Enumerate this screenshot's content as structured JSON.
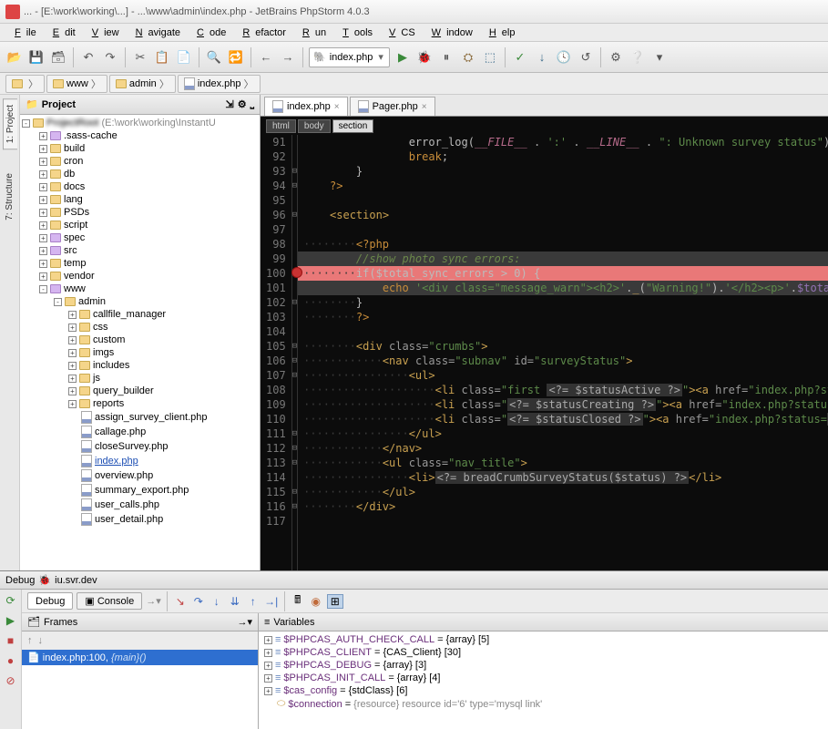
{
  "titlebar": "... - [E:\\work\\working\\...] - ...\\www\\admin\\index.php - JetBrains PhpStorm 4.0.3",
  "menu": [
    "File",
    "Edit",
    "View",
    "Navigate",
    "Code",
    "Refactor",
    "Run",
    "Tools",
    "VCS",
    "Window",
    "Help"
  ],
  "toolbar_combo": "index.php",
  "breadcrumbs": [
    {
      "label": "",
      "icon": "module"
    },
    {
      "label": "www",
      "icon": "folder"
    },
    {
      "label": "admin",
      "icon": "folder"
    },
    {
      "label": "index.php",
      "icon": "php"
    }
  ],
  "side_tabs": [
    "1: Project",
    "7: Structure"
  ],
  "project": {
    "header": "Project",
    "root_label": "",
    "root_path": "(E:\\work\\working\\InstantU",
    "items": [
      {
        "indent": 1,
        "toggle": "+",
        "icon": "folder-purple",
        "label": ".sass-cache"
      },
      {
        "indent": 1,
        "toggle": "+",
        "icon": "folder",
        "label": "build"
      },
      {
        "indent": 1,
        "toggle": "+",
        "icon": "folder",
        "label": "cron"
      },
      {
        "indent": 1,
        "toggle": "+",
        "icon": "folder",
        "label": "db"
      },
      {
        "indent": 1,
        "toggle": "+",
        "icon": "folder",
        "label": "docs"
      },
      {
        "indent": 1,
        "toggle": "+",
        "icon": "folder",
        "label": "lang"
      },
      {
        "indent": 1,
        "toggle": "+",
        "icon": "folder",
        "label": "PSDs"
      },
      {
        "indent": 1,
        "toggle": "+",
        "icon": "folder",
        "label": "script"
      },
      {
        "indent": 1,
        "toggle": "+",
        "icon": "folder-purple",
        "label": "spec"
      },
      {
        "indent": 1,
        "toggle": "+",
        "icon": "folder-purple",
        "label": "src"
      },
      {
        "indent": 1,
        "toggle": "+",
        "icon": "folder",
        "label": "temp"
      },
      {
        "indent": 1,
        "toggle": "+",
        "icon": "folder",
        "label": "vendor"
      },
      {
        "indent": 1,
        "toggle": "-",
        "icon": "folder-purple",
        "label": "www"
      },
      {
        "indent": 2,
        "toggle": "-",
        "icon": "folder",
        "label": "admin"
      },
      {
        "indent": 3,
        "toggle": "+",
        "icon": "folder",
        "label": "callfile_manager"
      },
      {
        "indent": 3,
        "toggle": "+",
        "icon": "folder",
        "label": "css"
      },
      {
        "indent": 3,
        "toggle": "+",
        "icon": "folder",
        "label": "custom"
      },
      {
        "indent": 3,
        "toggle": "+",
        "icon": "folder",
        "label": "imgs"
      },
      {
        "indent": 3,
        "toggle": "+",
        "icon": "folder",
        "label": "includes"
      },
      {
        "indent": 3,
        "toggle": "+",
        "icon": "folder",
        "label": "js"
      },
      {
        "indent": 3,
        "toggle": "+",
        "icon": "folder",
        "label": "query_builder"
      },
      {
        "indent": 3,
        "toggle": "+",
        "icon": "folder",
        "label": "reports"
      },
      {
        "indent": 3,
        "toggle": "",
        "icon": "php",
        "label": "assign_survey_client.php"
      },
      {
        "indent": 3,
        "toggle": "",
        "icon": "php",
        "label": "callage.php"
      },
      {
        "indent": 3,
        "toggle": "",
        "icon": "php",
        "label": "closeSurvey.php"
      },
      {
        "indent": 3,
        "toggle": "",
        "icon": "php",
        "label": "index.php",
        "link": true
      },
      {
        "indent": 3,
        "toggle": "",
        "icon": "php",
        "label": "overview.php"
      },
      {
        "indent": 3,
        "toggle": "",
        "icon": "php",
        "label": "summary_export.php"
      },
      {
        "indent": 3,
        "toggle": "",
        "icon": "php",
        "label": "user_calls.php"
      },
      {
        "indent": 3,
        "toggle": "",
        "icon": "php",
        "label": "user_detail.php"
      }
    ]
  },
  "editor_tabs": [
    {
      "label": "index.php",
      "active": true
    },
    {
      "label": "Pager.php",
      "active": false
    }
  ],
  "path_bar": [
    "html",
    "body",
    "section"
  ],
  "code": {
    "start": 91,
    "lines": [
      {
        "n": 91,
        "html": "                error_log(<span class='tok-const'>__FILE__</span> <span class='tok-op'>.</span> <span class='tok-str'>':'</span> <span class='tok-op'>.</span> <span class='tok-const'>__LINE__</span> <span class='tok-op'>.</span> <span class='tok-str'>\": Unknown survey status\"</span>);"
      },
      {
        "n": 92,
        "html": "                <span class='tok-kw'>break</span>;"
      },
      {
        "n": 93,
        "fold": "⊟",
        "html": "        }"
      },
      {
        "n": 94,
        "fold": "⊟",
        "html": "    <span class='tok-kw'>?&gt;</span>"
      },
      {
        "n": 95,
        "html": ""
      },
      {
        "n": 96,
        "fold": "⊟",
        "html": "    <span class='tok-tag'>&lt;section&gt;</span>"
      },
      {
        "n": 97,
        "html": ""
      },
      {
        "n": 98,
        "html": "<span class='ws'>········</span><span class='tok-kw'>&lt;?php</span>"
      },
      {
        "n": 99,
        "html": "<span class='ws'>········</span><span class='tok-cm'>//show photo sync errors:</span>",
        "hl2": true
      },
      {
        "n": 100,
        "bp": true,
        "hl": true,
        "html": "<span class='ws'>········</span>if($total_sync_errors &gt; 0) {"
      },
      {
        "n": 101,
        "hl2": true,
        "html": "<span class='ws'>············</span><span class='tok-kw'>echo</span> <span class='tok-str'>'&lt;div class=\"message_warn\"&gt;&lt;h2&gt;'</span>.<span class='tok-fn'>_</span>(<span class='tok-str'>\"Warning!\"</span>).<span class='tok-str'>'&lt;/h2&gt;&lt;p&gt;'</span>.<span class='tok-var'>$total_sy</span>"
      },
      {
        "n": 102,
        "fold": "⊟",
        "html": "<span class='ws'>········</span>}"
      },
      {
        "n": 103,
        "html": "<span class='ws'>········</span><span class='tok-kw'>?&gt;</span>"
      },
      {
        "n": 104,
        "html": ""
      },
      {
        "n": 105,
        "fold": "⊟",
        "html": "<span class='ws'>········</span><span class='tok-tag'>&lt;div</span> <span class='tok-attr'>class=</span><span class='tok-str'>\"crumbs\"</span><span class='tok-tag'>&gt;</span>"
      },
      {
        "n": 106,
        "fold": "⊟",
        "html": "<span class='ws'>············</span><span class='tok-tag'>&lt;nav</span> <span class='tok-attr'>class=</span><span class='tok-str'>\"subnav\"</span> <span class='tok-attr'>id=</span><span class='tok-str'>\"surveyStatus\"</span><span class='tok-tag'>&gt;</span>"
      },
      {
        "n": 107,
        "fold": "⊟",
        "html": "<span class='ws'>················</span><span class='tok-tag'>&lt;ul&gt;</span>"
      },
      {
        "n": 108,
        "html": "<span class='ws'>····················</span><span class='tok-tag'>&lt;li</span> <span class='tok-attr'>class=</span><span class='tok-str'>\"first </span><span class='tok-phpecho'>&lt;?= $statusActive ?&gt;</span><span class='tok-str'>\"</span><span class='tok-tag'>&gt;&lt;a</span> <span class='tok-attr'>href=</span><span class='tok-str'>\"index.php?status</span>"
      },
      {
        "n": 109,
        "html": "<span class='ws'>····················</span><span class='tok-tag'>&lt;li</span> <span class='tok-attr'>class=</span><span class='tok-str'>\"</span><span class='tok-phpecho'>&lt;?= $statusCreating ?&gt;</span><span class='tok-str'>\"</span><span class='tok-tag'>&gt;&lt;a</span> <span class='tok-attr'>href=</span><span class='tok-str'>\"index.php?status=</span><span class='tok-phpecho'>&lt;?</span>"
      },
      {
        "n": 110,
        "html": "<span class='ws'>····················</span><span class='tok-tag'>&lt;li</span> <span class='tok-attr'>class=</span><span class='tok-str'>\"</span><span class='tok-phpecho'>&lt;?= $statusClosed ?&gt;</span><span class='tok-str'>\"</span><span class='tok-tag'>&gt;&lt;a</span> <span class='tok-attr'>href=</span><span class='tok-str'>\"index.php?status=</span><span class='tok-phpecho'>&lt;?=</span> S"
      },
      {
        "n": 111,
        "fold": "⊟",
        "html": "<span class='ws'>················</span><span class='tok-tag'>&lt;/ul&gt;</span>"
      },
      {
        "n": 112,
        "fold": "⊟",
        "html": "<span class='ws'>············</span><span class='tok-tag'>&lt;/nav&gt;</span>"
      },
      {
        "n": 113,
        "fold": "⊟",
        "html": "<span class='ws'>············</span><span class='tok-tag'>&lt;ul</span> <span class='tok-attr'>class=</span><span class='tok-str'>\"nav_title\"</span><span class='tok-tag'>&gt;</span>"
      },
      {
        "n": 114,
        "html": "<span class='ws'>················</span><span class='tok-tag'>&lt;li&gt;</span><span class='tok-phpecho'>&lt;?= breadCrumbSurveyStatus($status) ?&gt;</span><span class='tok-tag'>&lt;/li&gt;</span>"
      },
      {
        "n": 115,
        "fold": "⊟",
        "html": "<span class='ws'>············</span><span class='tok-tag'>&lt;/ul&gt;</span>"
      },
      {
        "n": 116,
        "fold": "⊟",
        "html": "<span class='ws'>········</span><span class='tok-tag'>&lt;/div&gt;</span>"
      },
      {
        "n": 117,
        "html": ""
      }
    ]
  },
  "debug": {
    "title": "Debug",
    "config": "iu.svr.dev",
    "tabs": [
      {
        "label": "Debug",
        "active": true
      },
      {
        "label": "Console",
        "active": false
      }
    ],
    "frames_header": "Frames",
    "frame_current": "index.php:100,",
    "frame_current_fn": "{main}()",
    "vars_header": "Variables",
    "variables": [
      {
        "name": "$PHPCAS_AUTH_CHECK_CALL",
        "val": "{array} [5]"
      },
      {
        "name": "$PHPCAS_CLIENT",
        "val": "{CAS_Client} [30]"
      },
      {
        "name": "$PHPCAS_DEBUG",
        "val": "{array} [3]"
      },
      {
        "name": "$PHPCAS_INIT_CALL",
        "val": "{array} [4]"
      },
      {
        "name": "$cas_config",
        "val": "{stdClass} [6]"
      },
      {
        "name": "$connection",
        "val": "{resource} resource id='6' type='mysql link'",
        "res": true
      }
    ]
  }
}
